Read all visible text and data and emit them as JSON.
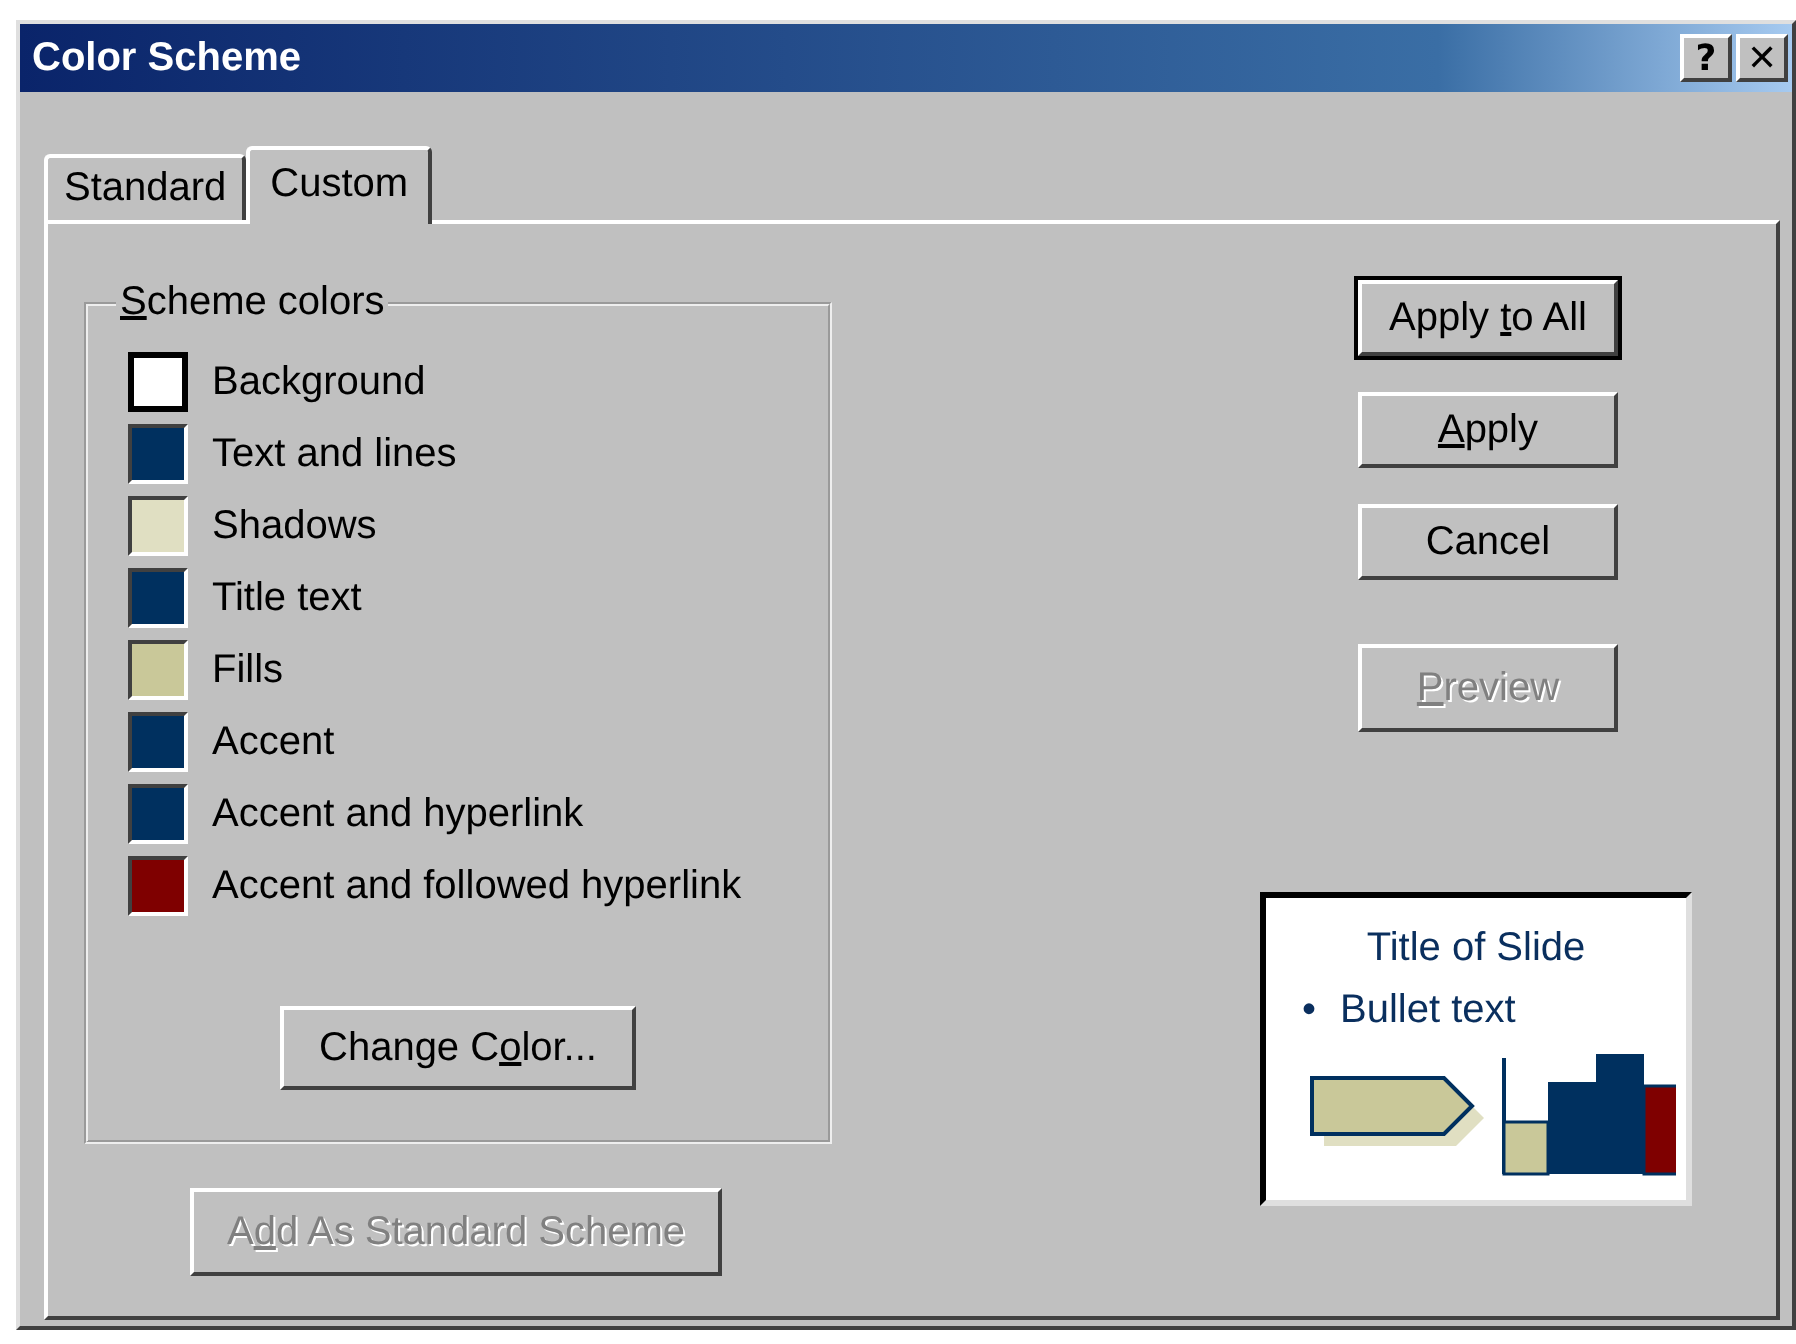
{
  "window": {
    "title": "Color Scheme",
    "title_buttons": [
      {
        "kind": "help",
        "label": "?"
      },
      {
        "kind": "close",
        "label": "✕"
      }
    ]
  },
  "tabs": [
    {
      "label": "Standard",
      "selected": false
    },
    {
      "label": "Custom",
      "selected": true
    }
  ],
  "scheme_colors": {
    "title": {
      "key": "S",
      "after": "cheme colors"
    },
    "items": [
      {
        "label": "Background",
        "color": "#ffffff",
        "selected": true
      },
      {
        "label": "Text and lines",
        "color": "#00305f",
        "selected": false
      },
      {
        "label": "Shadows",
        "color": "#e0dfc2",
        "selected": false
      },
      {
        "label": "Title text",
        "color": "#00305f",
        "selected": false
      },
      {
        "label": "Fills",
        "color": "#c9c899",
        "selected": false
      },
      {
        "label": "Accent",
        "color": "#00305f",
        "selected": false
      },
      {
        "label": "Accent and hyperlink",
        "color": "#00305f",
        "selected": false
      },
      {
        "label": "Accent and followed hyperlink",
        "color": "#7f0000",
        "selected": false
      }
    ],
    "change_button": {
      "before": "Change C",
      "key": "o",
      "after": "lor...",
      "disabled": false,
      "default": false
    }
  },
  "add_button": {
    "before": "A",
    "key": "d",
    "after": "d As Standard Scheme",
    "disabled": true,
    "default": false
  },
  "action_buttons": [
    {
      "before": "Apply ",
      "key": "t",
      "after": "o All",
      "disabled": false,
      "default": true
    },
    {
      "key": "A",
      "after": "pply",
      "disabled": false,
      "default": false
    },
    {
      "before": "Cancel",
      "disabled": false,
      "default": false
    },
    {
      "key": "P",
      "after": "review",
      "disabled": true,
      "default": false
    }
  ],
  "preview": {
    "title": "Title of Slide",
    "bullet": "•",
    "bullet_text": "Bullet text"
  }
}
